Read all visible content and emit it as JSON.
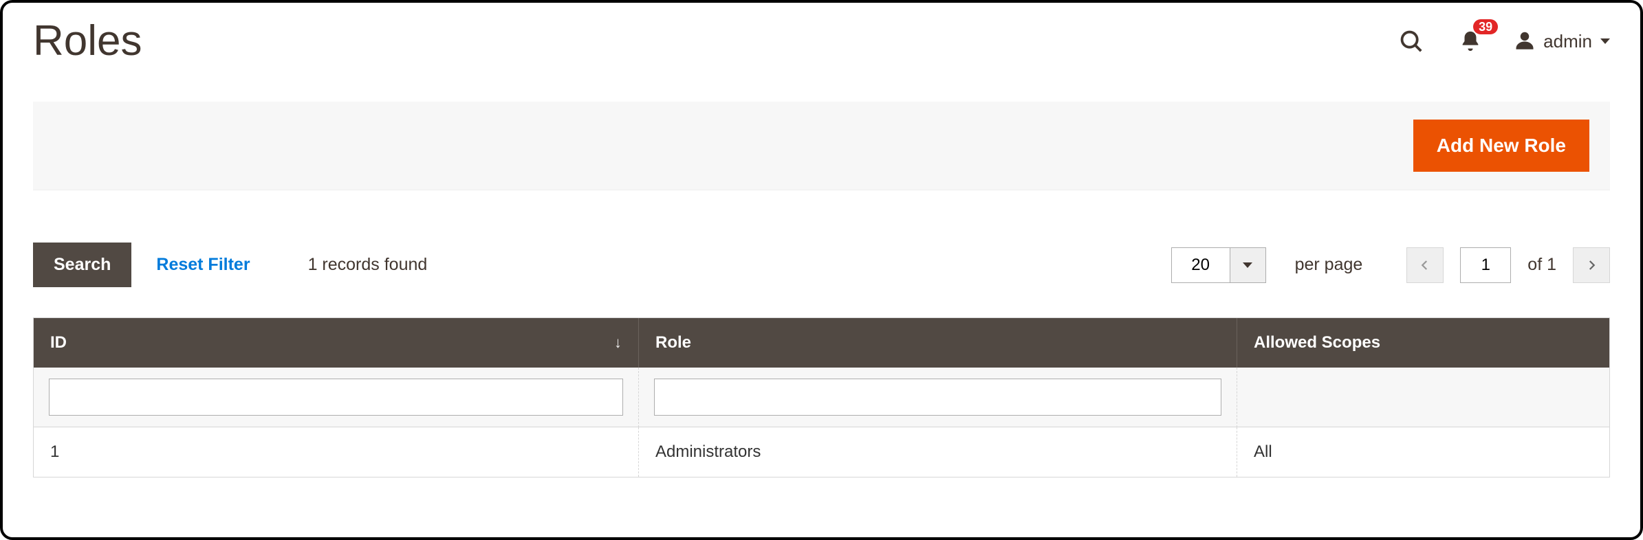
{
  "header": {
    "title": "Roles",
    "notifications_count": "39",
    "username": "admin"
  },
  "actions": {
    "add_new_role": "Add New Role"
  },
  "toolbar": {
    "search_label": "Search",
    "reset_filter_label": "Reset Filter",
    "records_found": "1 records found",
    "page_size": "20",
    "per_page_label": "per page",
    "current_page": "1",
    "total_pages_label": "of 1"
  },
  "grid": {
    "columns": {
      "id": "ID",
      "role": "Role",
      "allowed_scopes": "Allowed Scopes"
    },
    "filters": {
      "id": "",
      "role": ""
    },
    "rows": [
      {
        "id": "1",
        "role": "Administrators",
        "allowed_scopes": "All"
      }
    ]
  },
  "colors": {
    "accent": "#eb5202",
    "header_bg": "#514943",
    "link": "#007bdb",
    "badge": "#e22626"
  }
}
